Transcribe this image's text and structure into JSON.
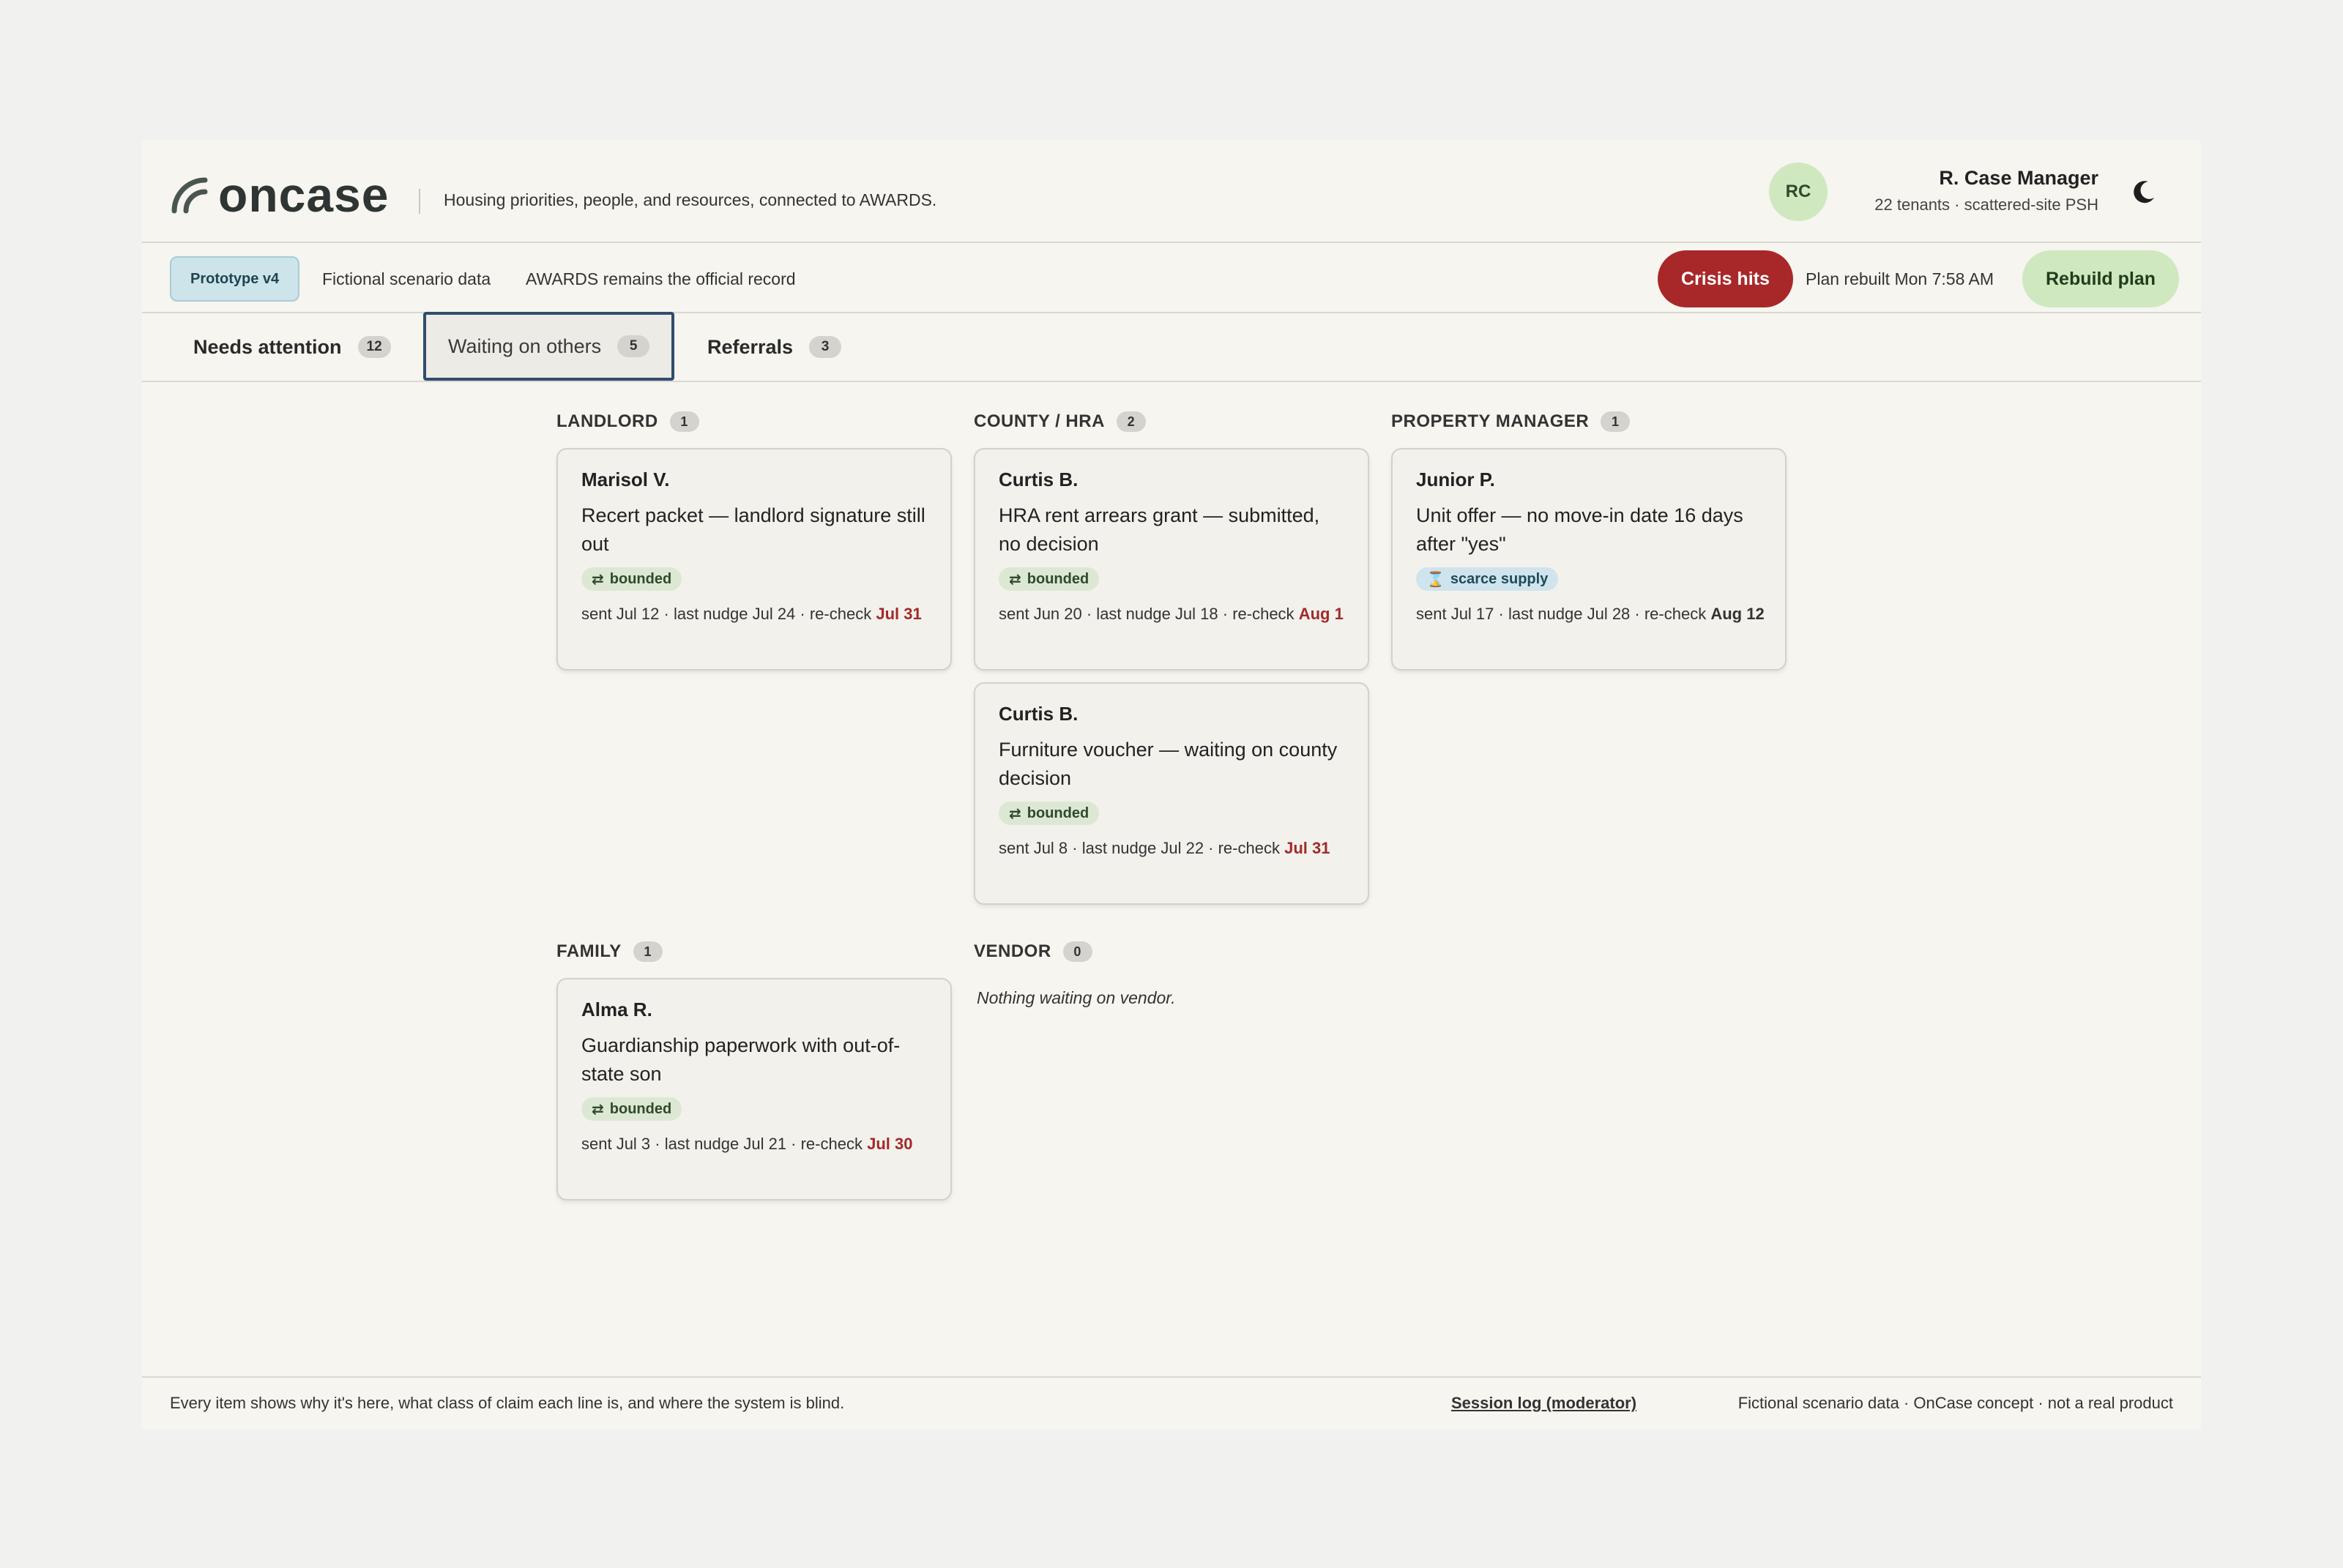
{
  "app": {
    "name": "oncase",
    "tagline": "Housing priorities, people, and resources, connected to AWARDS."
  },
  "user": {
    "initials": "RC",
    "name": "R. Case Manager",
    "subtitle": "22 tenants · scattered-site PSH"
  },
  "notice": {
    "badge": "Prototype v4",
    "fictional": "Fictional scenario data",
    "official": "AWARDS remains the official record",
    "crisis_label": "Crisis hits",
    "rebuilt": "Plan rebuilt Mon 7:58 AM",
    "rebuild_label": "Rebuild plan"
  },
  "tabs": [
    {
      "label": "Needs attention",
      "count": "12"
    },
    {
      "label": "Waiting on others",
      "count": "5"
    },
    {
      "label": "Referrals",
      "count": "3"
    }
  ],
  "sections": {
    "landlord": {
      "title": "LANDLORD",
      "count": "1"
    },
    "county": {
      "title": "COUNTY / HRA",
      "count": "2"
    },
    "pm": {
      "title": "PROPERTY MANAGER",
      "count": "1"
    },
    "family": {
      "title": "FAMILY",
      "count": "1"
    },
    "vendor": {
      "title": "VENDOR",
      "count": "0",
      "empty": "Nothing waiting on vendor."
    }
  },
  "cards": {
    "marisol": {
      "name": "Marisol V.",
      "desc": "Recert packet — landlord signature still out",
      "chip": "bounded",
      "meta": "sent Jul 12 · last nudge Jul 24 · re-check",
      "due": "Jul 31"
    },
    "curtis1": {
      "name": "Curtis B.",
      "desc": "HRA rent arrears grant — submitted, no decision",
      "chip": "bounded",
      "meta": "sent Jun 20 · last nudge Jul 18 · re-check",
      "due": "Aug 1"
    },
    "curtis2": {
      "name": "Curtis B.",
      "desc": "Furniture voucher — waiting on county decision",
      "chip": "bounded",
      "meta": "sent Jul 8 · last nudge Jul 22 · re-check",
      "due": "Jul 31"
    },
    "junior": {
      "name": "Junior P.",
      "desc": "Unit offer — no move-in date 16 days after \"yes\"",
      "chip": "scarce supply",
      "meta": "sent Jul 17 · last nudge Jul 28 · re-check",
      "due": "Aug 12"
    },
    "alma": {
      "name": "Alma R.",
      "desc": "Guardianship paperwork with out-of-state son",
      "chip": "bounded",
      "meta": "sent Jul 3 · last nudge Jul 21 · re-check",
      "due": "Jul 30"
    }
  },
  "footer": {
    "left": "Every item shows why it's here, what class of claim each line is, and where the system is blind.",
    "link": "Session log (moderator)",
    "right": "Fictional scenario data · OnCase concept · not a real product"
  },
  "colors": {
    "accent_red": "#a8282a",
    "accent_green": "#cfe8c0",
    "tab_active_border": "#2f4d6e"
  },
  "icons": {
    "logo": "signal-arcs-icon",
    "theme": "moon-icon",
    "bounded": "swap-arrows-icon",
    "scarce": "hourglass-icon"
  }
}
